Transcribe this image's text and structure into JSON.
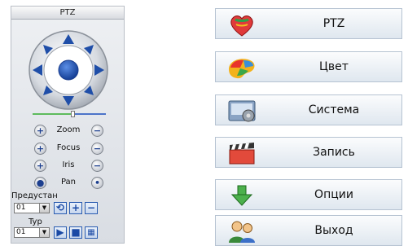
{
  "ptz": {
    "title": "PTZ",
    "controls": [
      {
        "label": "Zoom",
        "left_symbol": "+",
        "right_symbol": "−"
      },
      {
        "label": "Focus",
        "left_symbol": "+",
        "right_symbol": "−"
      },
      {
        "label": "Iris",
        "left_symbol": "+",
        "right_symbol": "−"
      },
      {
        "label": "Pan",
        "left_symbol": "●",
        "right_symbol": "•"
      }
    ],
    "preset": {
      "label": "Предустано",
      "value": "01"
    },
    "tour": {
      "label": "Typ",
      "value": "01"
    },
    "slider_fraction": 0.55
  },
  "menu": {
    "items": [
      {
        "label": "PTZ",
        "icon": "heart-icon"
      },
      {
        "label": "Цвет",
        "icon": "color-palette-icon"
      },
      {
        "label": "Система",
        "icon": "system-gear-icon"
      },
      {
        "label": "Запись",
        "icon": "clapperboard-icon"
      },
      {
        "label": "Опции",
        "icon": "download-arrow-icon"
      },
      {
        "label": "Выход",
        "icon": "users-icon"
      }
    ]
  }
}
